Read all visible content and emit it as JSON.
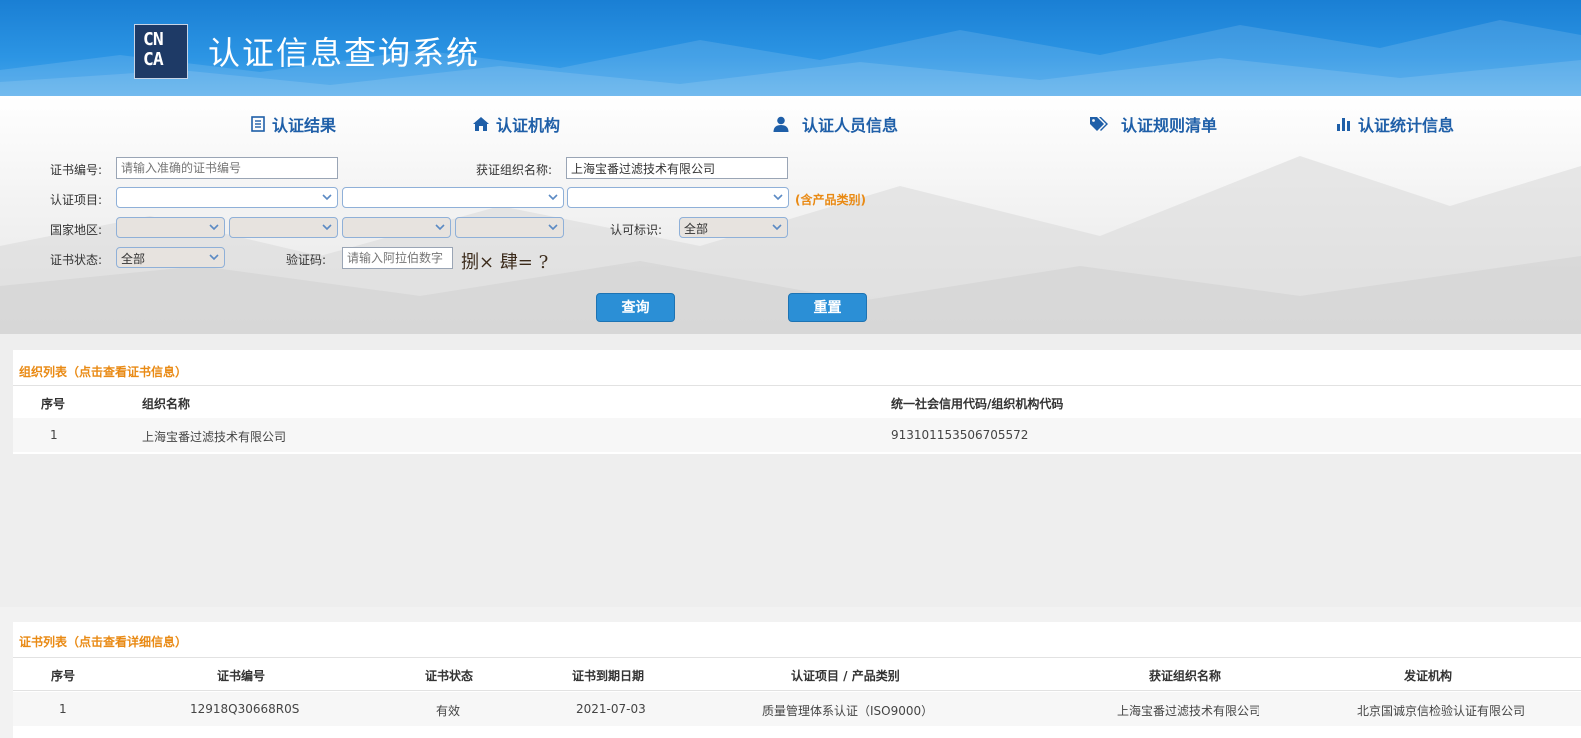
{
  "header": {
    "title": "认证信息查询系统",
    "logo_text": "CNCA"
  },
  "nav": [
    {
      "label": "认证结果",
      "icon": "list-icon"
    },
    {
      "label": "认证机构",
      "icon": "home-icon"
    },
    {
      "label": "认证人员信息",
      "icon": "user-icon"
    },
    {
      "label": "认证规则清单",
      "icon": "tags-icon"
    },
    {
      "label": "认证统计信息",
      "icon": "bar-chart-icon"
    }
  ],
  "search": {
    "cert_no_label": "证书编号:",
    "cert_no_placeholder": "请输入准确的证书编号",
    "org_name_label": "获证组织名称:",
    "org_name_value": "上海宝番过滤技术有限公司",
    "project_label": "认证项目:",
    "project_note": "(含产品类别)",
    "region_label": "国家地区:",
    "accredit_label": "认可标识:",
    "accredit_value": "全部",
    "status_label": "证书状态:",
    "status_value": "全部",
    "captcha_label": "验证码:",
    "captcha_placeholder": "请输入阿拉伯数字",
    "captcha_text": "捌× 肆= ?",
    "query_button": "查询",
    "reset_button": "重置"
  },
  "org_table": {
    "title": "组织列表（点击查看证书信息）",
    "columns": [
      "序号",
      "组织名称",
      "统一社会信用代码/组织机构代码"
    ],
    "rows": [
      [
        "1",
        "上海宝番过滤技术有限公司",
        "913101153506705572"
      ]
    ]
  },
  "cert_table": {
    "title": "证书列表（点击查看详细信息）",
    "columns": [
      "序号",
      "证书编号",
      "证书状态",
      "证书到期日期",
      "认证项目 / 产品类别",
      "获证组织名称",
      "发证机构"
    ],
    "rows": [
      [
        "1",
        "12918Q30668R0S",
        "有效",
        "2021-07-03",
        "质量管理体系认证（ISO9000）",
        "上海宝番过滤技术有限公司",
        "北京国诚京信检验认证有限公司"
      ]
    ]
  },
  "colors": {
    "accent": "#2b8fd6",
    "nav_text": "#1f5fa8",
    "orange": "#e98a14"
  }
}
